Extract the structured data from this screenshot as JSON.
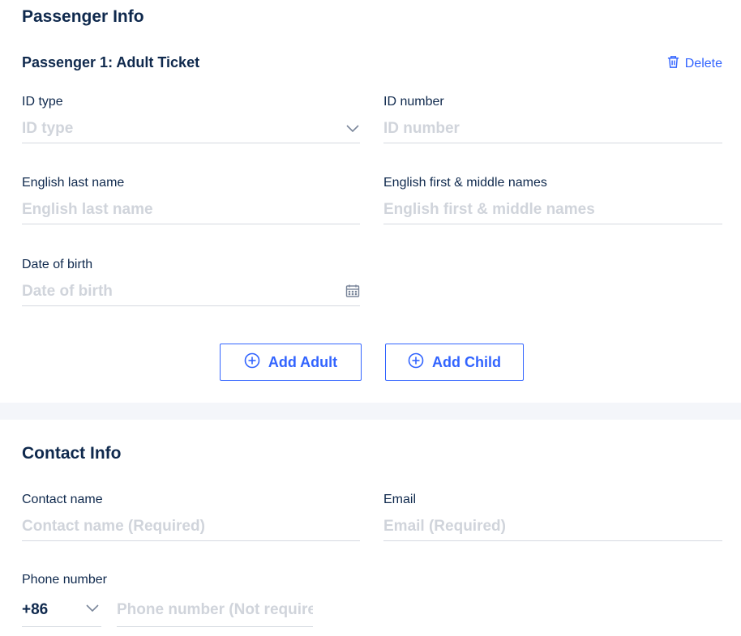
{
  "passenger_info": {
    "title": "Passenger Info",
    "passenger_title": "Passenger 1: Adult Ticket",
    "delete_label": "Delete",
    "id_type": {
      "label": "ID type",
      "placeholder": "ID type",
      "icon": "chevron-down-icon"
    },
    "id_number": {
      "label": "ID number",
      "placeholder": "ID number"
    },
    "last_name": {
      "label": "English last name",
      "placeholder": "English last name"
    },
    "first_names": {
      "label": "English first & middle names",
      "placeholder": "English first & middle names"
    },
    "dob": {
      "label": "Date of birth",
      "placeholder": "Date of birth",
      "icon": "calendar-icon"
    },
    "add_adult_label": "Add Adult",
    "add_child_label": "Add Child"
  },
  "contact_info": {
    "title": "Contact Info",
    "contact_name": {
      "label": "Contact name",
      "placeholder": "Contact name (Required)"
    },
    "email": {
      "label": "Email",
      "placeholder": "Email (Required)"
    },
    "phone": {
      "label": "Phone number",
      "country_code": "+86",
      "placeholder": "Phone number (Not required)"
    }
  },
  "colors": {
    "accent": "#3264ff",
    "text": "#0f294d",
    "placeholder": "#d0d4db",
    "divider": "#f4f6fa",
    "underline": "#d5d9e0"
  }
}
